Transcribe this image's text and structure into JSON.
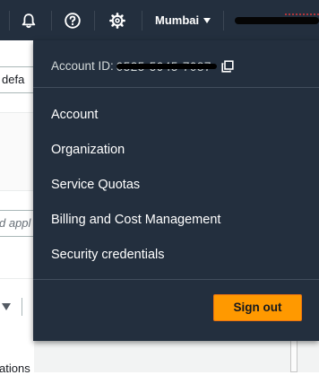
{
  "topbar": {
    "icons": [
      "bell-icon",
      "help-icon",
      "gear-icon"
    ],
    "region": "Mumbai",
    "region_caret_icon": "caret-down-icon",
    "user_redacted": true
  },
  "background": {
    "field_1_text": "defa",
    "field_2_placeholder": "d appl",
    "bottom_text": "ations"
  },
  "account_menu": {
    "account_id_label": "Account ID:",
    "account_id_value": "0525-5945-7087",
    "account_id_redacted": true,
    "copy_icon": "copy-icon",
    "items": [
      {
        "label": "Account"
      },
      {
        "label": "Organization"
      },
      {
        "label": "Service Quotas"
      },
      {
        "label": "Billing and Cost Management"
      },
      {
        "label": "Security credentials"
      }
    ],
    "sign_out_label": "Sign out"
  },
  "colors": {
    "nav_bg": "#232f3e",
    "menu_text": "#ffffff",
    "secondary_text": "#d5dbdb",
    "accent": "#ff9900"
  }
}
